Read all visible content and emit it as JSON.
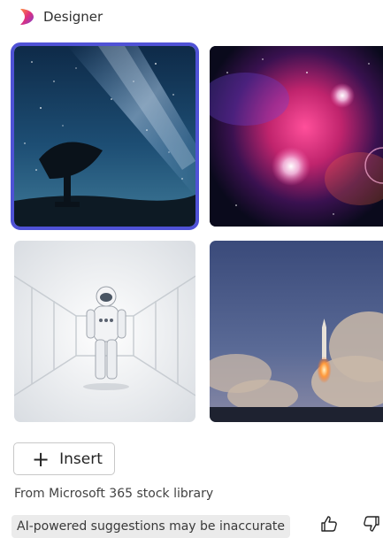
{
  "app": {
    "title": "Designer",
    "logo_icon": "designer-logo-icon"
  },
  "images": [
    {
      "name": "radio telescope under milky way night sky",
      "selected": true
    },
    {
      "name": "pink and purple nebula with glowing stars",
      "selected": false
    },
    {
      "name": "astronaut in white futuristic corridor",
      "selected": false
    },
    {
      "name": "rocket launch with smoke clouds",
      "selected": false
    }
  ],
  "actions": {
    "insert_label": "Insert",
    "insert_icon": "plus-icon"
  },
  "footer": {
    "source": "From Microsoft 365 stock library",
    "disclaimer": "AI-powered suggestions may be inaccurate",
    "like_icon": "thumbs-up-icon",
    "dislike_icon": "thumbs-down-icon"
  },
  "colors": {
    "selection_border": "#4f52d6",
    "text": "#242424",
    "disclaimer_bg": "#ebebeb"
  }
}
